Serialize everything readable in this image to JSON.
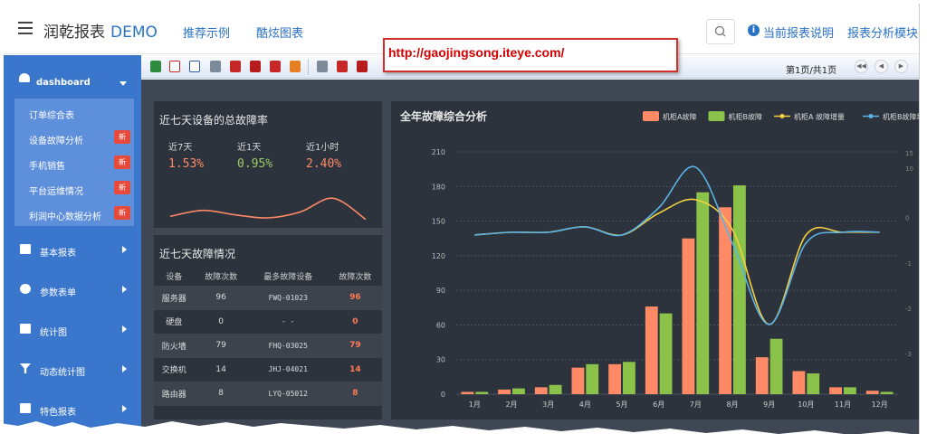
{
  "header": {
    "brand": "润乾报表",
    "brand_demo": "DEMO",
    "nav": [
      "推荐示例",
      "酷炫图表"
    ],
    "report_help": "当前报表说明",
    "report_analysis": "报表分析模块"
  },
  "watermark_url": "http://gaojingsong.iteye.com/",
  "toolbar": {
    "page_info": "第1页/共1页",
    "icons": [
      "excel-icon",
      "pdf-icon",
      "word-icon",
      "print-icon",
      "export-icon",
      "export-icon",
      "export-icon",
      "image-icon",
      "print-icon",
      "export-icon",
      "export-icon"
    ]
  },
  "sidebar": {
    "head_label": "dashboard",
    "sub_items": [
      {
        "label": "订单综合表",
        "badge": ""
      },
      {
        "label": "设备故障分析",
        "badge": "新"
      },
      {
        "label": "手机销售",
        "badge": "新"
      },
      {
        "label": "平台运维情况",
        "badge": "新"
      },
      {
        "label": "利润中心数据分析",
        "badge": "新"
      }
    ],
    "menu_items": [
      "基本报表",
      "参数表单",
      "统计图",
      "动态统计图",
      "特色报表"
    ]
  },
  "kpi_panel": {
    "title": "近七天设备的总故障率",
    "items": [
      {
        "label": "近7天",
        "value": "1.53%",
        "color": "#ff8a65"
      },
      {
        "label": "近1天",
        "value": "0.95%",
        "color": "#9ccc65"
      },
      {
        "label": "近1小时",
        "value": "2.40%",
        "color": "#ff8a65"
      }
    ]
  },
  "fault_table": {
    "title": "近七天故障情况",
    "headers": [
      "设备",
      "故障次数",
      "最多故障设备",
      "故障次数"
    ],
    "rows": [
      [
        "服务器",
        "96",
        "FWQ-01023",
        "96"
      ],
      [
        "硬盘",
        "0",
        "- -",
        "0"
      ],
      [
        "防火墙",
        "79",
        "FHQ-03025",
        "79"
      ],
      [
        "交换机",
        "14",
        "JHJ-04021",
        "14"
      ],
      [
        "路由器",
        "8",
        "LYQ-05012",
        "8"
      ]
    ]
  },
  "chart_data": {
    "type": "bar",
    "title": "全年故障综合分析",
    "categories": [
      "1月",
      "2月",
      "3月",
      "4月",
      "5月",
      "6月",
      "7月",
      "8月",
      "9月",
      "10月",
      "11月",
      "12月"
    ],
    "series": [
      {
        "name": "机柜A故障",
        "type": "bar",
        "color": "#ff8a65",
        "values": [
          2,
          4,
          6,
          23,
          26,
          76,
          135,
          162,
          32,
          20,
          6,
          3
        ]
      },
      {
        "name": "机柜B故障",
        "type": "bar",
        "color": "#8bc34a",
        "values": [
          2,
          5,
          8,
          26,
          28,
          70,
          175,
          181,
          48,
          18,
          6,
          2
        ]
      },
      {
        "name": "机柜A 故障增量",
        "type": "line",
        "color": "#f5d142",
        "values": [
          0,
          1,
          1,
          3,
          0,
          8,
          13,
          2,
          -33,
          0,
          1,
          1
        ]
      },
      {
        "name": "机柜B故障增量",
        "type": "line",
        "color": "#5ab4e6",
        "values": [
          0,
          1,
          1,
          3,
          0,
          10,
          25,
          -3,
          -33,
          -3,
          1,
          1
        ]
      }
    ],
    "ylim": [
      0,
      210
    ],
    "yticks": [
      0,
      30,
      60,
      90,
      120,
      150,
      180,
      210
    ],
    "y2_ticks_visible": [
      "10",
      "0",
      "-1",
      "-2",
      "-3"
    ],
    "y2_top_label": "15",
    "legend": "top-right",
    "grid": true
  },
  "sparkline": {
    "values": [
      1.2,
      1.6,
      1.3,
      1.1,
      1.5,
      2.4,
      1.0
    ]
  }
}
